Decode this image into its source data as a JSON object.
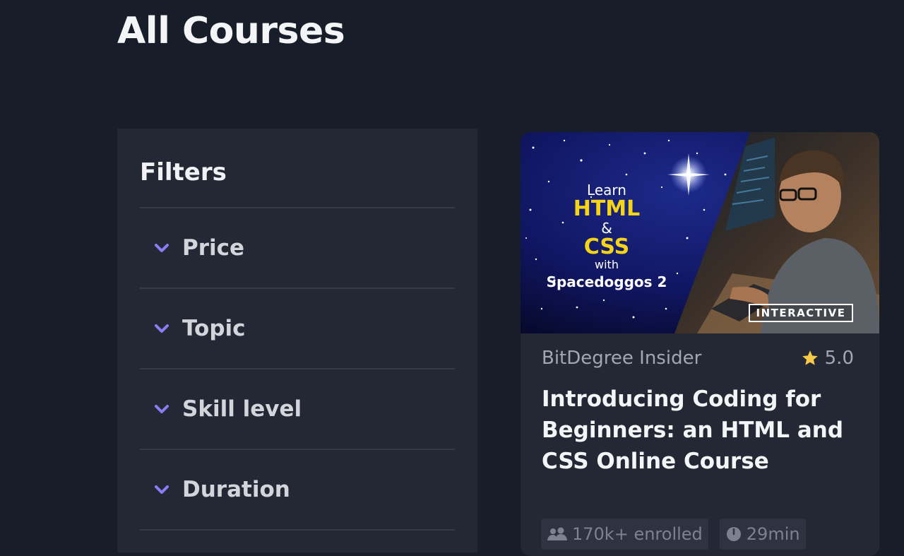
{
  "page": {
    "title": "All Courses"
  },
  "filters": {
    "title": "Filters",
    "items": [
      {
        "label": "Price",
        "icon": "chevron-down-icon"
      },
      {
        "label": "Topic",
        "icon": "chevron-down-icon"
      },
      {
        "label": "Skill level",
        "icon": "chevron-down-icon"
      },
      {
        "label": "Duration",
        "icon": "chevron-down-icon"
      }
    ]
  },
  "course_card": {
    "thumbnail": {
      "line1": "Learn",
      "line2": "HTML",
      "line3": "&",
      "line4": "CSS",
      "line5": "with",
      "line6": "Spacedoggos 2",
      "badge": "INTERACTIVE"
    },
    "author": "BitDegree Insider",
    "rating": "5.0",
    "title": "Introducing Coding for Beginners: an HTML and CSS Online Course",
    "chips": [
      {
        "icon": "users-icon",
        "label": "170k+ enrolled"
      },
      {
        "icon": "clock-icon",
        "label": "29min"
      }
    ]
  },
  "colors": {
    "background": "#181e29",
    "panel": "#232834",
    "accent": "#8b7cf6",
    "star": "#f7c948",
    "thumbnail_highlight": "#f5d418"
  }
}
